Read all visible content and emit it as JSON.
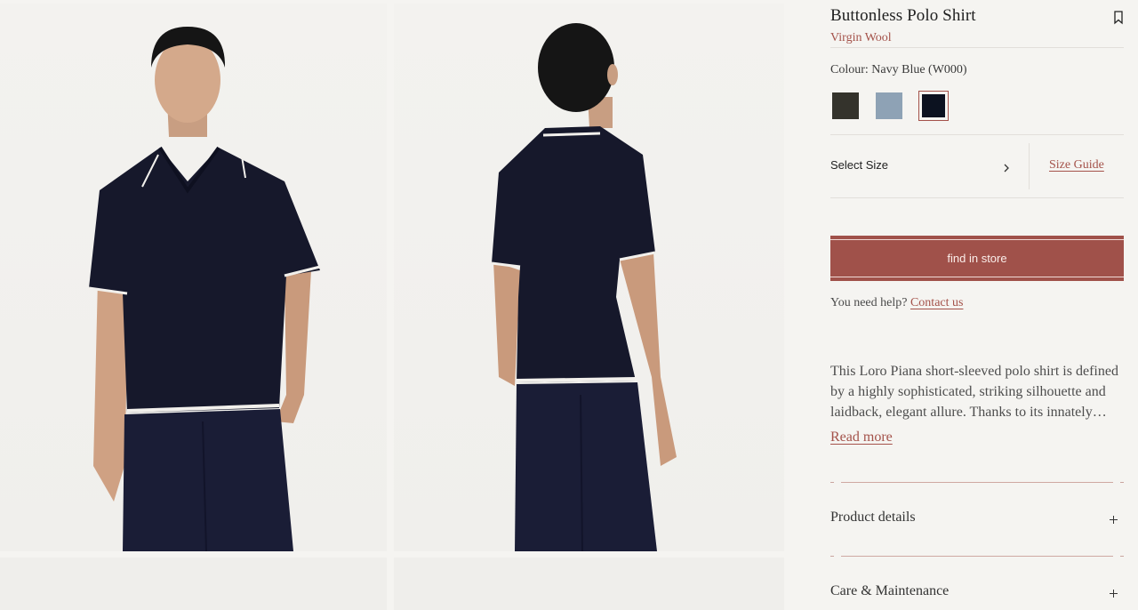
{
  "product": {
    "title": "Buttonless Polo Shirt",
    "material": "Virgin Wool",
    "colour_label": "Colour: Navy Blue (W000)"
  },
  "swatches": [
    {
      "name": "dark-olive",
      "color": "#34332c",
      "selected": false
    },
    {
      "name": "light-blue",
      "color": "#8ea2b5",
      "selected": false
    },
    {
      "name": "navy-blue",
      "color": "#0c1220",
      "selected": true
    }
  ],
  "size": {
    "select_label": "Select Size",
    "guide_label": "Size Guide"
  },
  "cta": {
    "label": "find in store"
  },
  "help": {
    "text": "You need help?",
    "link": "Contact us"
  },
  "description": {
    "text": "This Loro Piana short-sleeved polo shirt is defined by a highly sophisticated, striking silhouette and laidback, elegant allure. Thanks to its innately…",
    "read_more": "Read more"
  },
  "accordion": [
    {
      "label": "Product details"
    },
    {
      "label": "Care & Maintenance"
    }
  ],
  "colors": {
    "accent": "#a4524a",
    "cta_bg": "#a0514a",
    "shirt": "#16182b",
    "background": "#f5f4f1"
  },
  "icons": {
    "bookmark": "bookmark-icon",
    "chevron": "chevron-right-icon",
    "expand": "plus-icon"
  }
}
